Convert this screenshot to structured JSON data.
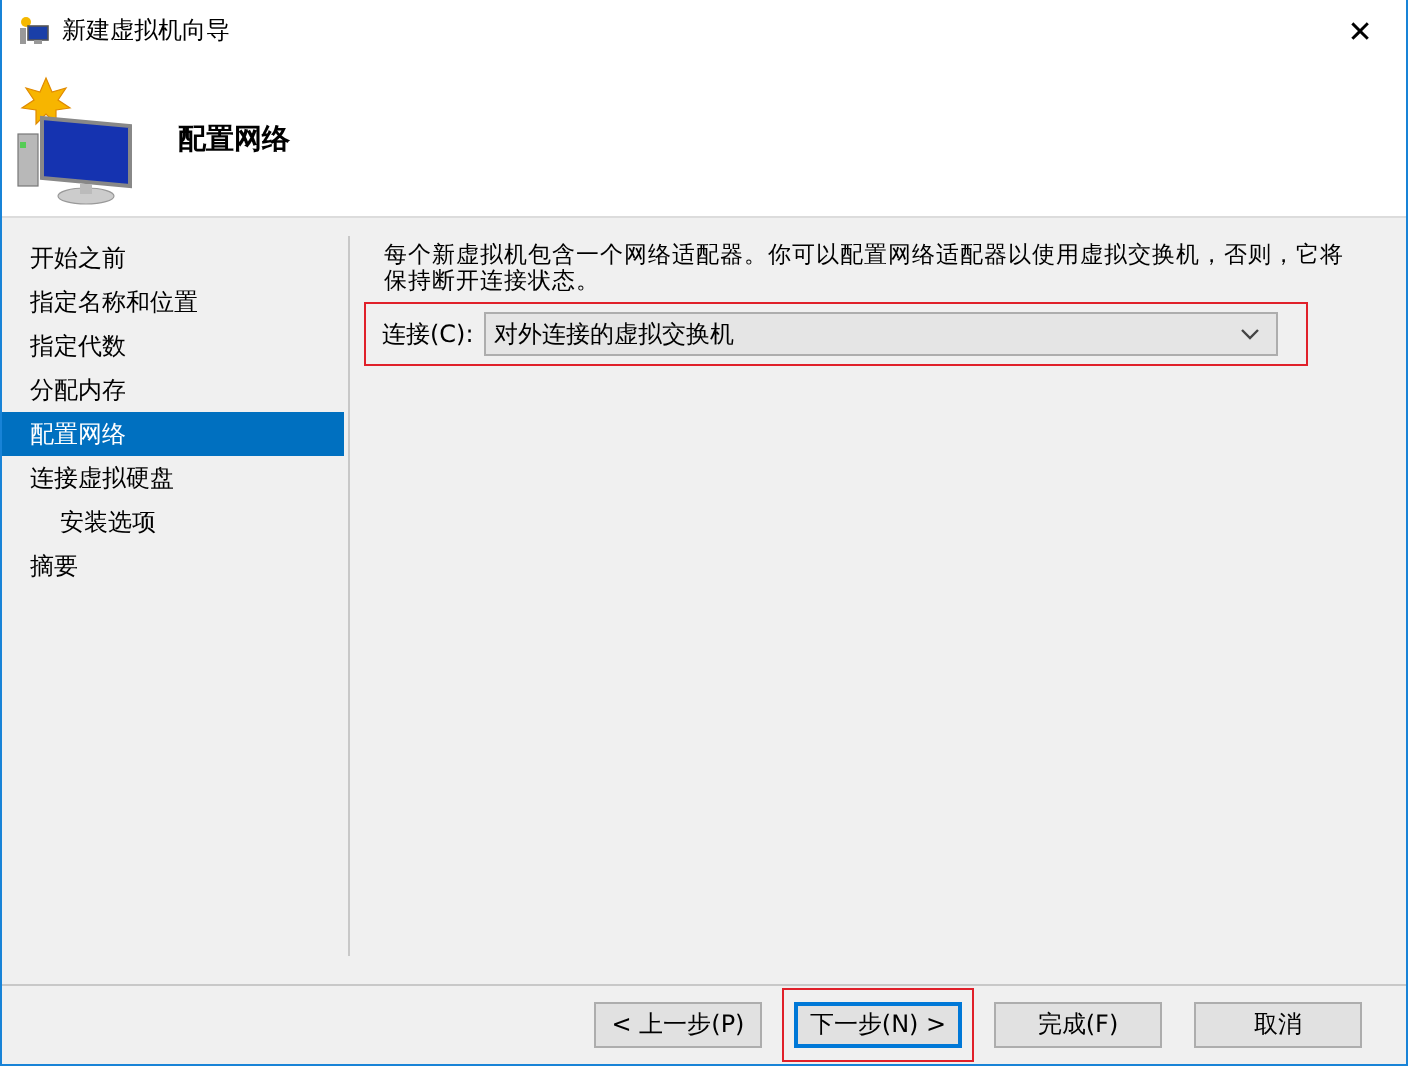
{
  "window": {
    "title": "新建虚拟机向导",
    "close": "✕"
  },
  "header": {
    "title": "配置网络"
  },
  "sidebar": {
    "items": [
      {
        "label": "开始之前",
        "selected": false
      },
      {
        "label": "指定名称和位置",
        "selected": false
      },
      {
        "label": "指定代数",
        "selected": false
      },
      {
        "label": "分配内存",
        "selected": false
      },
      {
        "label": "配置网络",
        "selected": true
      },
      {
        "label": "连接虚拟硬盘",
        "selected": false,
        "children": [
          {
            "label": "安装选项",
            "selected": false
          }
        ]
      },
      {
        "label": "摘要",
        "selected": false
      }
    ]
  },
  "description": "每个新虚拟机包含一个网络适配器。你可以配置网络适配器以使用虚拟交换机，否则，它将保持断开连接状态。",
  "connection": {
    "label": "连接(C):",
    "value": "对外连接的虚拟交换机",
    "highlighted": true
  },
  "buttons": [
    {
      "label": "< 上一步(P)",
      "default": false,
      "highlighted": false
    },
    {
      "label": "下一步(N) >",
      "default": true,
      "highlighted": true
    },
    {
      "label": "完成(F)",
      "default": false,
      "highlighted": false
    },
    {
      "label": "取消",
      "default": false,
      "highlighted": false
    }
  ]
}
